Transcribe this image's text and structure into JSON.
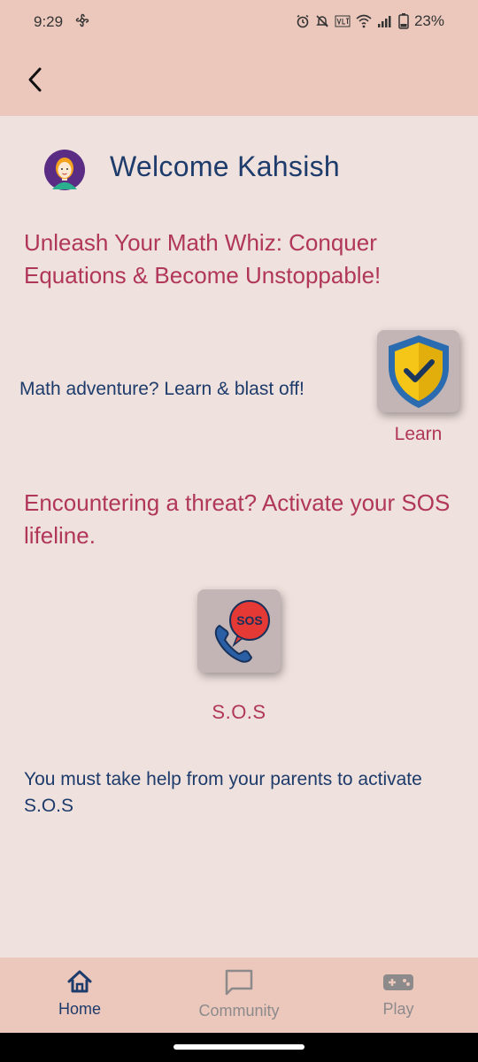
{
  "status_bar": {
    "time": "9:29",
    "battery": "23%"
  },
  "header": {
    "back_icon": "chevron-left-icon"
  },
  "main": {
    "welcome": "Welcome Kahsish",
    "headline": "Unleash Your Math Whiz: Conquer Equations & Become Unstoppable!",
    "learn_prompt": "Math adventure? Learn & blast off!",
    "learn_label": "Learn",
    "threat_prompt": "Encountering a threat? Activate your SOS lifeline.",
    "sos_badge": "SOS",
    "sos_label": "S.O.S",
    "parents_note": "You must take help from your parents to activate S.O.S"
  },
  "bottom_nav": {
    "items": [
      {
        "label": "Home",
        "icon": "home-icon",
        "active": true
      },
      {
        "label": "Community",
        "icon": "chat-bubble-icon",
        "active": false
      },
      {
        "label": "Play",
        "icon": "gamepad-icon",
        "active": false
      }
    ]
  },
  "colors": {
    "header_bg": "#ecc8bc",
    "page_bg": "#efe1de",
    "accent_text": "#b0365a",
    "primary_text": "#1d3b6b",
    "inactive": "#8d8a8c"
  }
}
